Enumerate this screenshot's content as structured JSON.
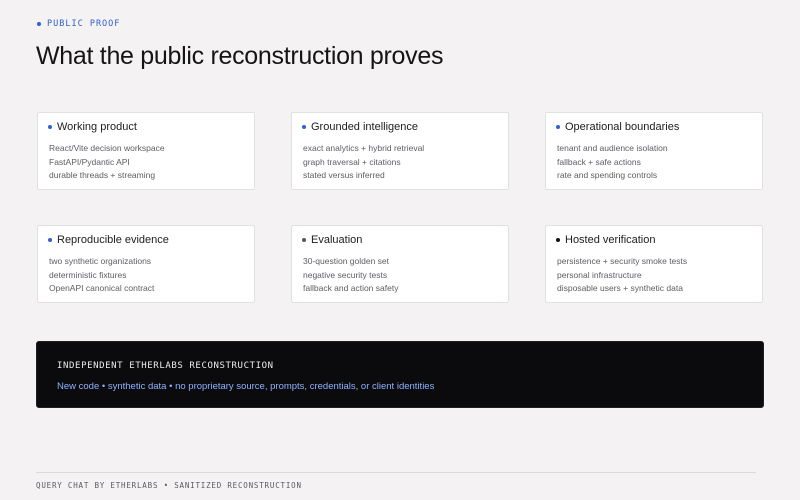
{
  "header": {
    "eyebrow": "PUBLIC PROOF",
    "title": "What the public reconstruction proves"
  },
  "cards": [
    {
      "title": "Working product",
      "dot_color": "#2f5fd0",
      "lines": [
        "React/Vite decision workspace",
        "FastAPI/Pydantic API",
        "durable threads + streaming"
      ]
    },
    {
      "title": "Grounded intelligence",
      "dot_color": "#2f5fd0",
      "lines": [
        "exact analytics + hybrid retrieval",
        "graph traversal + citations",
        "stated versus inferred"
      ]
    },
    {
      "title": "Operational boundaries",
      "dot_color": "#2f5fd0",
      "lines": [
        "tenant and audience isolation",
        "fallback + safe actions",
        "rate and spending controls"
      ]
    },
    {
      "title": "Reproducible evidence",
      "dot_color": "#2f5fd0",
      "lines": [
        "two synthetic organizations",
        "deterministic fixtures",
        "OpenAPI canonical contract"
      ]
    },
    {
      "title": "Evaluation",
      "dot_color": "#55555a",
      "lines": [
        "30-question golden set",
        "negative security tests",
        "fallback and action safety"
      ]
    },
    {
      "title": "Hosted verification",
      "dot_color": "#111111",
      "lines": [
        "persistence + security smoke tests",
        "personal infrastructure",
        "disposable users + synthetic data"
      ]
    }
  ],
  "banner": {
    "title": "INDEPENDENT ETHERLABS RECONSTRUCTION",
    "subtitle": "New code • synthetic data • no proprietary source, prompts, credentials, or client identities"
  },
  "footer": {
    "text": "QUERY CHAT BY ETHERLABS • SANITIZED RECONSTRUCTION"
  }
}
